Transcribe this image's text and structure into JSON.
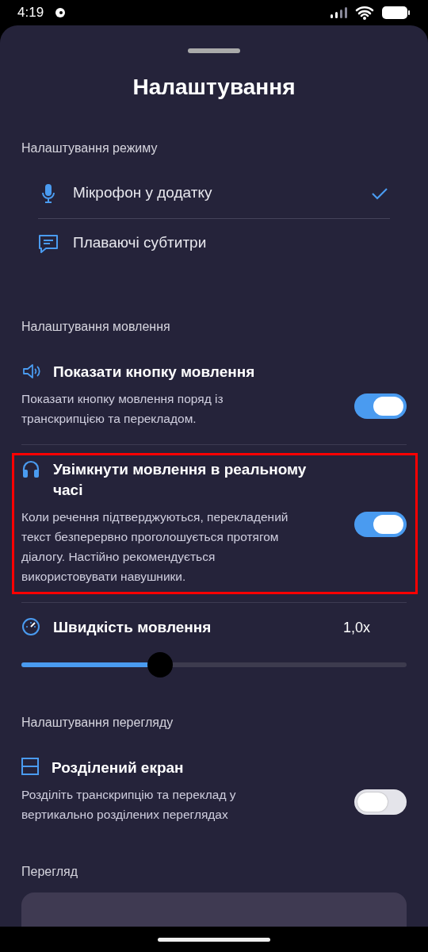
{
  "status_bar": {
    "time": "4:19"
  },
  "title": "Налаштування",
  "sections": [
    {
      "heading": "Налаштування режиму",
      "kind": "modes",
      "items": [
        {
          "label": "Мікрофон у додатку",
          "selected": true
        },
        {
          "label": "Плаваючі субтитри",
          "selected": false
        }
      ]
    },
    {
      "heading": "Налаштування мовлення",
      "kind": "settings",
      "items": [
        {
          "kind": "toggle",
          "title": "Показати кнопку мовлення",
          "description": "Показати кнопку мовлення поряд із транскрипцією та перекладом.",
          "on": true
        },
        {
          "kind": "toggle",
          "title": "Увімкнути мовлення в реальному часі",
          "description": "Коли речення підтверджуються, перекладений текст безперервно проголошується протягом діалогу. Настійно рекомендується використовувати навушники.",
          "on": true,
          "highlighted": true
        },
        {
          "kind": "slider",
          "title": "Швидкість мовлення",
          "reading": "1,0x",
          "level": 0.36
        }
      ]
    },
    {
      "heading": "Налаштування перегляду",
      "kind": "settings",
      "items": [
        {
          "kind": "toggle",
          "title": "Розділений екран",
          "description": "Розділіть транскрипцію та переклад у вертикально розділених переглядах",
          "on": false
        }
      ]
    },
    {
      "heading": "Перегляд",
      "kind": "card"
    }
  ]
}
